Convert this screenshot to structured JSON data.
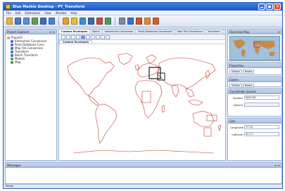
{
  "window": {
    "title": "Blue Marble Desktop - PT_Transform"
  },
  "menu": [
    "File",
    "Edit",
    "Extensions",
    "View",
    "Window",
    "Help"
  ],
  "toolbar": {
    "buttons": [
      {
        "icon": "open-folder-icon",
        "color": "#e8b33a"
      },
      {
        "icon": "save-icon",
        "color": "#4a78c8"
      },
      {
        "icon": "image-icon",
        "color": "#5a8fd6"
      },
      {
        "icon": "layers-icon",
        "color": "#6a9a4a"
      },
      {
        "icon": "grid-icon",
        "color": "#3d6fc0"
      },
      {
        "icon": "table-icon",
        "color": "#4a7fd0"
      },
      {
        "icon": "globe-icon",
        "color": "#e0a030"
      },
      {
        "icon": "point-icon",
        "color": "#d9c23a"
      },
      {
        "icon": "polygon-icon",
        "color": "#3a8fd0"
      },
      {
        "icon": "line-icon",
        "color": "#3a6ab8"
      },
      {
        "icon": "transform-icon",
        "color": "#c84a3a"
      },
      {
        "icon": "export-icon",
        "color": "#4a9a60"
      },
      {
        "icon": "settings-icon",
        "color": "#7a8aa8"
      },
      {
        "icon": "help-icon",
        "color": "#3a72c8"
      },
      {
        "icon": "cancel-icon",
        "color": "#d05030"
      },
      {
        "icon": "refresh-icon",
        "color": "#e08a30"
      },
      {
        "icon": "run-icon",
        "color": "#d06030"
      }
    ]
  },
  "project_explorer": {
    "title": "Project Explorer",
    "tree": [
      {
        "label": "Project1",
        "level": 0,
        "icon_color": "#e0b040"
      },
      {
        "label": "Interactive Conversion",
        "level": 1,
        "icon_color": "#4a78c8"
      },
      {
        "label": "Point Database Conv.",
        "level": 1,
        "icon_color": "#4a78c8"
      },
      {
        "label": "Map File Conversion",
        "level": 1,
        "icon_color": "#4a78c8"
      },
      {
        "label": "Transform",
        "level": 1,
        "icon_color": "#4a78c8"
      },
      {
        "label": "Batch Transform",
        "level": 1,
        "icon_color": "#4a78c8"
      },
      {
        "label": "Models",
        "level": 1,
        "icon_color": "#6a9a4a"
      },
      {
        "label": "Map",
        "level": 1,
        "icon_color": "#6a9a4a"
      }
    ]
  },
  "document": {
    "tabs": [
      "Custom Envelopes",
      "Name",
      "Interactive Conversion",
      "Point Database Conversion",
      "Map File Conversion",
      "Transform",
      "Batch Transfo"
    ],
    "active_tab": "Custom Envelopes",
    "inner_tab": "Custom Envelopes",
    "map_colors": {
      "outline": "#c0392b",
      "selected": "#1a1a1a"
    }
  },
  "overview_panel": {
    "title": "Overview Map"
  },
  "properties_panel": {
    "title": "Properties",
    "segments": [
      "Visible",
      "Name"
    ]
  },
  "layers_panel": {
    "title": "Layers",
    "segments": [
      "Visible",
      "Name"
    ]
  },
  "coordinate_panel": {
    "title": "Coordinate System",
    "fields": [
      {
        "label": "System",
        "value": "WGS 84",
        "dim": false
      },
      {
        "label": "Datum",
        "value": "",
        "dim": true
      }
    ]
  },
  "geo_panel": {
    "title": "Geo",
    "fields": [
      {
        "label": "Longitude",
        "value": "17.55"
      },
      {
        "label": "Latitude",
        "value": "42.11"
      }
    ]
  },
  "messages": {
    "title": "Messages"
  },
  "status": {
    "text": "Ready"
  }
}
